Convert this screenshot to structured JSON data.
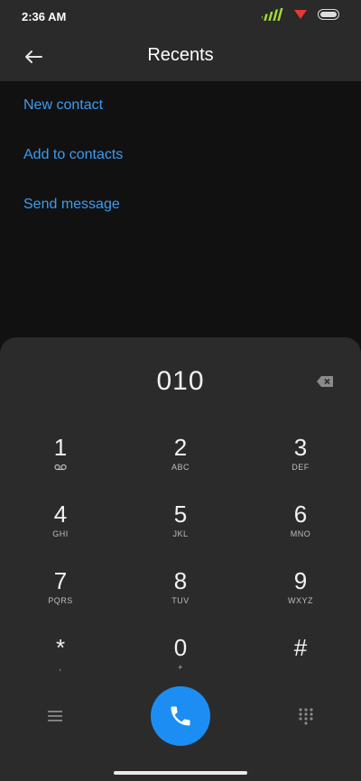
{
  "status_bar": {
    "time": "2:36 AM"
  },
  "header": {
    "title": "Recents"
  },
  "actions": [
    {
      "label": "New contact"
    },
    {
      "label": "Add to contacts"
    },
    {
      "label": "Send message"
    }
  ],
  "dialpad": {
    "number": "010",
    "keys": [
      {
        "digit": "1",
        "letters": ""
      },
      {
        "digit": "2",
        "letters": "ABC"
      },
      {
        "digit": "3",
        "letters": "DEF"
      },
      {
        "digit": "4",
        "letters": "GHI"
      },
      {
        "digit": "5",
        "letters": "JKL"
      },
      {
        "digit": "6",
        "letters": "MNO"
      },
      {
        "digit": "7",
        "letters": "PQRS"
      },
      {
        "digit": "8",
        "letters": "TUV"
      },
      {
        "digit": "9",
        "letters": "WXYZ"
      },
      {
        "digit": "*",
        "letters": ","
      },
      {
        "digit": "0",
        "letters": "+"
      },
      {
        "digit": "#",
        "letters": ""
      }
    ]
  },
  "colors": {
    "accent": "#1c8ef3",
    "link": "#3d9cf0",
    "signal": "#a4d93a",
    "wifi": "#e53935",
    "background": "#111111",
    "panel": "#2b2b2b"
  },
  "icons": [
    "back-arrow-icon",
    "signal-icon",
    "wifi-icon",
    "battery-icon",
    "backspace-icon",
    "voicemail-icon",
    "menu-icon",
    "phone-icon",
    "keypad-icon"
  ]
}
